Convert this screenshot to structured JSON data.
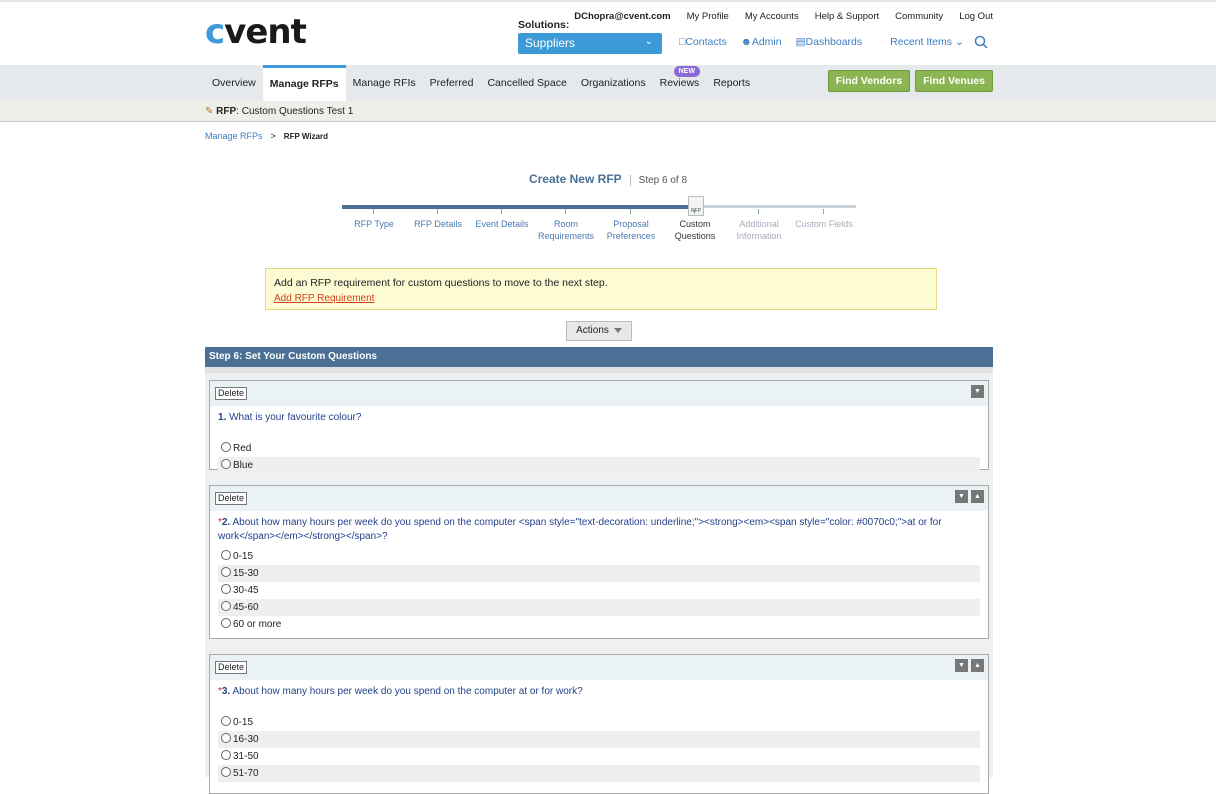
{
  "header": {
    "logo": "cvent",
    "email": "DChopra@cvent.com",
    "links": [
      "My Profile",
      "My Accounts",
      "Help & Support",
      "Community",
      "Log Out"
    ],
    "solutions_label": "Solutions:",
    "solutions_value": "Suppliers",
    "quick_links": [
      "Contacts",
      "Admin",
      "Dashboards"
    ],
    "recent_items": "Recent Items"
  },
  "nav": {
    "items": [
      "Overview",
      "Manage RFPs",
      "Manage RFIs",
      "Preferred",
      "Cancelled Space",
      "Organizations",
      "Reviews",
      "Reports"
    ],
    "new_badge": "NEW",
    "find_vendors": "Find Vendors",
    "find_venues": "Find Venues"
  },
  "rfp_bar": {
    "label": "RFP",
    "name": ": Custom Questions Test 1"
  },
  "breadcrumb": {
    "parent": "Manage RFPs",
    "sep": ">",
    "current": "RFP Wizard"
  },
  "wizard": {
    "title": "Create New RFP",
    "step": "Step 6 of 8",
    "icon_text": "RFP",
    "steps": [
      {
        "l1": "RFP Type",
        "l2": ""
      },
      {
        "l1": "RFP Details",
        "l2": ""
      },
      {
        "l1": "Event Details",
        "l2": ""
      },
      {
        "l1": "Room",
        "l2": "Requirements"
      },
      {
        "l1": "Proposal",
        "l2": "Preferences"
      },
      {
        "l1": "Custom",
        "l2": "Questions"
      },
      {
        "l1": "Additional",
        "l2": "Information"
      },
      {
        "l1": "Custom Fields",
        "l2": ""
      }
    ]
  },
  "alert": {
    "message": "Add an RFP requirement for custom questions to move to the next step.",
    "link": "Add RFP Requirement"
  },
  "actions_label": "Actions",
  "section_title": "Step 6: Set Your Custom Questions",
  "delete_label": "Delete",
  "questions": [
    {
      "req": "",
      "num": "1.",
      "text": " What is your favourite colour?",
      "options": [
        "Red",
        "Blue"
      ]
    },
    {
      "req": "*",
      "num": "2.",
      "text": " About how many hours per week do you spend on the computer <span style=\"text-decoration: underline;\"><strong><em><span style=\"color: #0070c0;\">at or for work</span></em></strong></span>?",
      "options": [
        "0-15",
        "15-30",
        "30-45",
        "45-60",
        "60 or more"
      ]
    },
    {
      "req": "*",
      "num": "3.",
      "text": " About how many hours per week do you spend on the computer at or for work?",
      "options": [
        "0-15",
        "16-30",
        "31-50",
        "51-70"
      ]
    }
  ]
}
